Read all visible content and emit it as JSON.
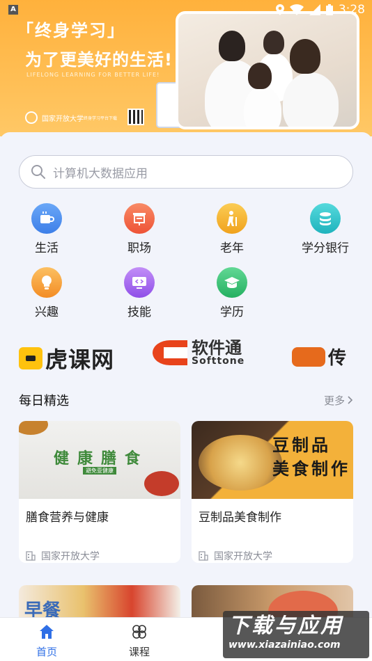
{
  "status_bar": {
    "notif_icon": "A",
    "time": "3:28"
  },
  "banner": {
    "title_line1": "「终身学习」",
    "title_line2": "为了更美好的生活!",
    "subtitle_en": "LIFELONG LEARNING FOR BETTER LIFE!",
    "org_logo_text": "国家开放大学",
    "small_text": "终身学习平台下载"
  },
  "search": {
    "placeholder": "计算机大数据应用"
  },
  "categories": [
    {
      "label": "生活",
      "icon": "cup-icon",
      "color": "#4a8df0"
    },
    {
      "label": "职场",
      "icon": "board-icon",
      "color": "#f3684a"
    },
    {
      "label": "老年",
      "icon": "elder-icon",
      "color": "#f5b431"
    },
    {
      "label": "学分银行",
      "icon": "coins-icon",
      "color": "#2ec1c9"
    },
    {
      "label": "兴趣",
      "icon": "bulb-icon",
      "color": "#f7a33a"
    },
    {
      "label": "技能",
      "icon": "screen-code-icon",
      "color": "#a86ef0"
    },
    {
      "label": "学历",
      "icon": "graduation-cap-icon",
      "color": "#3cc37a"
    }
  ],
  "partners": {
    "p1": "虎课网",
    "p2_cn": "软件通",
    "p2_en": "Softtone",
    "p3": "传"
  },
  "daily": {
    "title": "每日精选",
    "more": "更多",
    "cards": [
      {
        "title": "膳食营养与健康",
        "source": "国家开放大学",
        "img_big": "健康膳食",
        "img_small": "避免亚健康"
      },
      {
        "title": "豆制品美食制作",
        "source": "国家开放大学",
        "img_big": "豆制品 美食制作"
      },
      {
        "img_big": "早餐"
      },
      {}
    ]
  },
  "bottom_nav": [
    {
      "label": "首页",
      "active": true
    },
    {
      "label": "课程",
      "active": false
    }
  ],
  "watermark": {
    "cn": "下载与应用",
    "en": "www.xiazainiao.com"
  }
}
